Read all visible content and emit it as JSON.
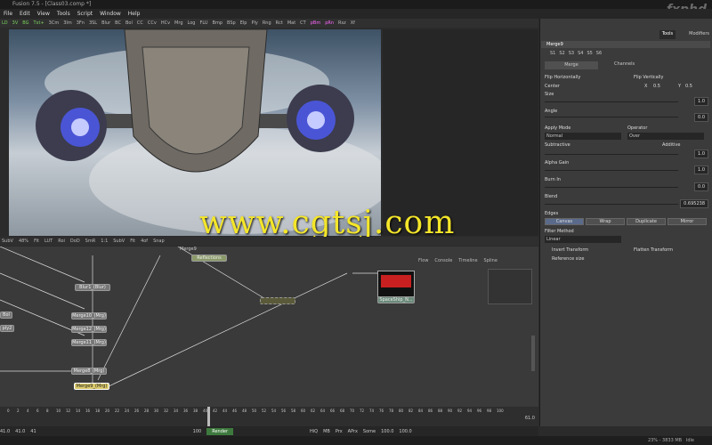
{
  "title": "Fusion 7.5 - [Class03.comp *]",
  "logo": "fxphd",
  "menu": [
    "File",
    "Edit",
    "View",
    "Tools",
    "Script",
    "Window",
    "Help"
  ],
  "toolbar": [
    "LD",
    "3V",
    "BG",
    "Txt+",
    "3Cm",
    "3Im",
    "3Fn",
    "3SL",
    "Blur",
    "BC",
    "Bol",
    "CC",
    "CCv",
    "HCv",
    "Mrg",
    "Log",
    "FLU",
    "Bmp",
    "BSp",
    "Elp",
    "Ply",
    "Rng",
    "Rct",
    "Mat",
    "CT",
    "pBm",
    "pRn",
    "Rsz",
    "Xf"
  ],
  "viewer_tools": [
    "SubV",
    "48%",
    "Fit",
    "LUT",
    "Roi",
    "DoD",
    "SmR",
    "1:1",
    "SubV",
    "Fit",
    "4of",
    "Snap"
  ],
  "watermark": "www.cgtsj.com",
  "flow_tabs": [
    "Flow",
    "Console",
    "Timeline",
    "Spline"
  ],
  "nodes": {
    "reflections": "Reflections",
    "blur1": "Blur1_(Blur)",
    "merge10": "Merge10_(Mrg)",
    "merge12": "Merge12_(Mrg)",
    "merge11": "Merge11_(Mrg)",
    "merge8": "Merge8_(Mrg)",
    "merge9": "Merge9_(Mrg)",
    "spaceship": "SpaceShip_N...",
    "bol": "Bol",
    "ply2": "ply2",
    "merge9_top": "Merge9"
  },
  "right_tabs": [
    "Tools",
    "Modifiers"
  ],
  "panel": {
    "tool_name": "Merge9",
    "subtabs": [
      "S1",
      "S2",
      "S3",
      "S4",
      "S5",
      "S6"
    ],
    "tab_merge": "Merge",
    "tab_channels": "Channels",
    "flip_h": "Flip Horizontally",
    "flip_v": "Flip Vertically",
    "center": "Center",
    "center_x_label": "X",
    "center_x": "0.5",
    "center_y_label": "Y",
    "center_y": "0.5",
    "size": "Size",
    "size_val": "1.0",
    "angle": "Angle",
    "angle_val": "0.0",
    "apply_mode": "Apply Mode",
    "apply_mode_val": "Normal",
    "operator": "Operator",
    "operator_val": "Over",
    "subtractive": "Subtractive",
    "additive": "Additive",
    "additive_val": "1.0",
    "alpha_gain": "Alpha Gain",
    "alpha_gain_val": "1.0",
    "burn_in": "Burn In",
    "burn_in_val": "0.0",
    "blend": "Blend",
    "blend_val": "0.695238",
    "edges": "Edges",
    "edge_btns": [
      "Canvas",
      "Wrap",
      "Duplicate",
      "Mirror"
    ],
    "filter_method": "Filter Method",
    "filter_val": "Linear",
    "invert_transform": "Invert Transform",
    "flatten_transform": "Flatten Transform",
    "reference_size": "Reference size"
  },
  "timeline": {
    "ticks": [
      "0",
      "2",
      "4",
      "6",
      "8",
      "10",
      "12",
      "14",
      "16",
      "18",
      "20",
      "22",
      "24",
      "26",
      "28",
      "30",
      "32",
      "34",
      "36",
      "38",
      "40",
      "42",
      "44",
      "46",
      "48",
      "50",
      "52",
      "54",
      "56",
      "58",
      "60",
      "62",
      "64",
      "66",
      "68",
      "70",
      "72",
      "74",
      "76",
      "78",
      "80",
      "82",
      "84",
      "86",
      "88",
      "90",
      "92",
      "94",
      "96",
      "98",
      "100"
    ],
    "end": "61.0",
    "current": "41"
  },
  "controls": {
    "start": "41.0",
    "start2": "41.0",
    "current": "41",
    "end_frame": "100",
    "render": "Render",
    "hiq": "HiQ",
    "mb": "MB",
    "prx": "Prx",
    "aprx": "APrx",
    "some": "Some",
    "out1": "100.0",
    "out2": "100.0"
  },
  "status": "23% - 3833 MB",
  "status_idle": "Idle"
}
